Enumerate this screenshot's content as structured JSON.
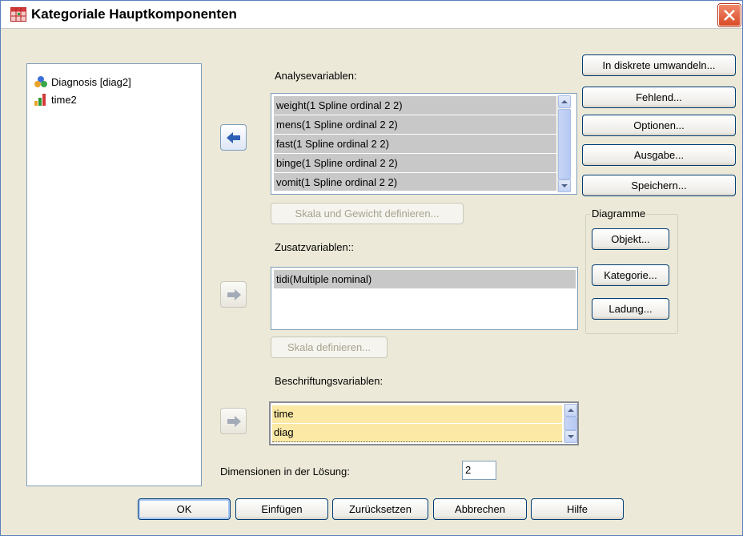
{
  "window": {
    "title": "Kategoriale Hauptkomponenten"
  },
  "source_list": {
    "items": [
      {
        "label": "Diagnosis [diag2]",
        "icon": "nominal-variable-icon"
      },
      {
        "label": "time2",
        "icon": "scale-variable-icon"
      }
    ]
  },
  "analysis": {
    "label": "Analysevariablen:",
    "items": [
      "weight(1 Spline ordinal 2 2)",
      "mens(1 Spline ordinal 2 2)",
      "fast(1 Spline ordinal 2 2)",
      "binge(1 Spline ordinal 2 2)",
      "vomit(1 Spline ordinal 2 2)"
    ],
    "define_button": "Skala und Gewicht definieren..."
  },
  "supplementary": {
    "label": "Zusatzvariablen::",
    "items": [
      "tidi(Multiple nominal)"
    ],
    "define_button": "Skala definieren..."
  },
  "labeling": {
    "label": "Beschriftungsvariablen:",
    "items": [
      "time",
      "diag"
    ]
  },
  "dimensions": {
    "label": "Dimensionen in der Lösung:",
    "value": "2"
  },
  "right_buttons": {
    "discretize": "In diskrete umwandeln...",
    "missing": "Fehlend...",
    "options": "Optionen...",
    "output": "Ausgabe...",
    "save": "Speichern..."
  },
  "plots": {
    "legend": "Diagramme",
    "object": "Objekt...",
    "category": "Kategorie...",
    "loading": "Ladung..."
  },
  "bottom_buttons": {
    "ok": "OK",
    "paste": "Einfügen",
    "reset": "Zurücksetzen",
    "cancel": "Abbrechen",
    "help": "Hilfe"
  },
  "colors": {
    "dialog_bg": "#ECE9D8",
    "selection_gray": "#C8C8C8",
    "label_highlight": "#FCE9A6",
    "arrow_blue": "#2E5FB5",
    "close_red": "#D94A26"
  }
}
